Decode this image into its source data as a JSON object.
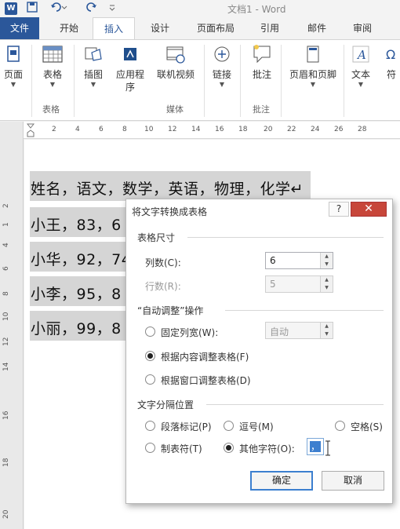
{
  "titlebar": {
    "title": "文档1 - Word",
    "app_logo": "W"
  },
  "tabs": [
    "文件",
    "开始",
    "插入",
    "设计",
    "页面布局",
    "引用",
    "邮件",
    "审阅"
  ],
  "ribbon": {
    "buttons": [
      {
        "label": "页面",
        "icon": "page-icon"
      },
      {
        "label": "表格",
        "icon": "table-icon"
      },
      {
        "label": "插图",
        "icon": "illustration-icon"
      },
      {
        "label": "应用程",
        "label2": "序",
        "icon": "apps-icon"
      },
      {
        "label": "联机视频",
        "icon": "video-icon"
      },
      {
        "label": "链接",
        "icon": "link-icon"
      },
      {
        "label": "批注",
        "icon": "comment-icon"
      },
      {
        "label": "页眉和页脚",
        "icon": "header-footer-icon"
      },
      {
        "label": "文本",
        "icon": "text-icon"
      },
      {
        "label": "符",
        "icon": "symbol-icon"
      }
    ],
    "groups": [
      "表格",
      "媒体",
      "批注"
    ]
  },
  "ruler": {
    "ticks": [
      "2",
      "4",
      "6",
      "8",
      "10",
      "12",
      "14",
      "16",
      "18",
      "20",
      "22",
      "24",
      "26",
      "28"
    ]
  },
  "vruler": {
    "ticks": [
      "1",
      "2",
      "4",
      "6",
      "8",
      "10",
      "12",
      "14",
      "16",
      "18",
      "20"
    ]
  },
  "document": {
    "lines": [
      "姓名，语文，数学，英语，物理，化学↵",
      "小王，83，6",
      "小华，92，74",
      "小李，95，8",
      "小丽，99，8"
    ]
  },
  "dialog": {
    "title": "将文字转换成表格",
    "help": "?",
    "close": "✕",
    "size_section": "表格尺寸",
    "columns_label": "列数(C):",
    "columns_value": "6",
    "rows_label": "行数(R):",
    "rows_value": "5",
    "autofit_section": "“自动调整”操作",
    "fixed_width_label": "固定列宽(W):",
    "fixed_width_value": "自动",
    "fit_content_label": "根据内容调整表格(F)",
    "fit_window_label": "根据窗口调整表格(D)",
    "separator_section": "文字分隔位置",
    "sep_paragraph": "段落标记(P)",
    "sep_comma": "逗号(M)",
    "sep_space": "空格(S)",
    "sep_tab": "制表符(T)",
    "sep_other": "其他字符(O):",
    "sep_other_value": "，",
    "ok": "确定",
    "cancel": "取消"
  }
}
